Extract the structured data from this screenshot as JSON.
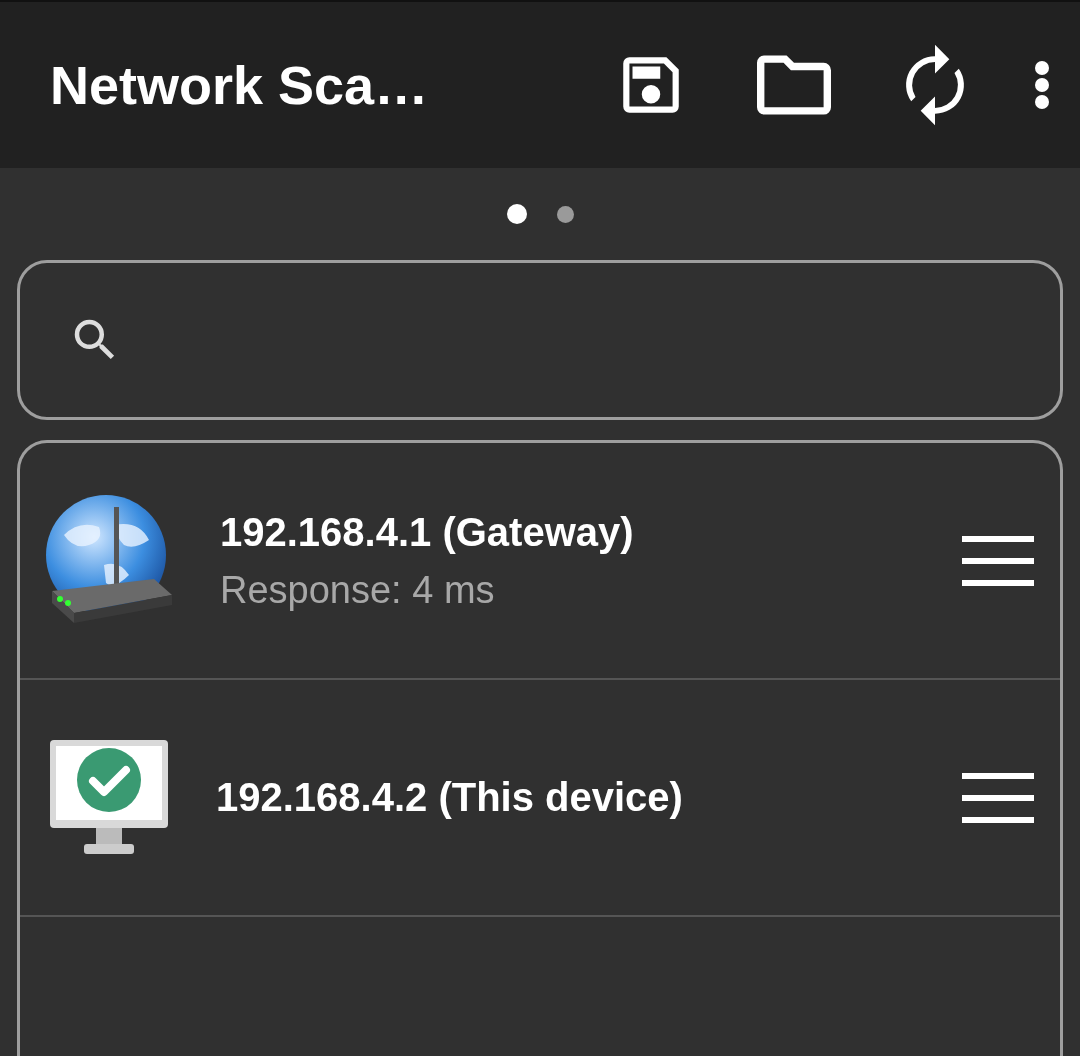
{
  "app_bar": {
    "title": "Network Sca…"
  },
  "pager": [
    {
      "selected": true
    },
    {
      "selected": false
    }
  ],
  "devices": [
    {
      "kind": "router",
      "address": "192.168.4.1 (Gateway)",
      "detail": "Response: 4 ms"
    },
    {
      "kind": "computer",
      "address": "192.168.4.2 (This device)"
    }
  ]
}
